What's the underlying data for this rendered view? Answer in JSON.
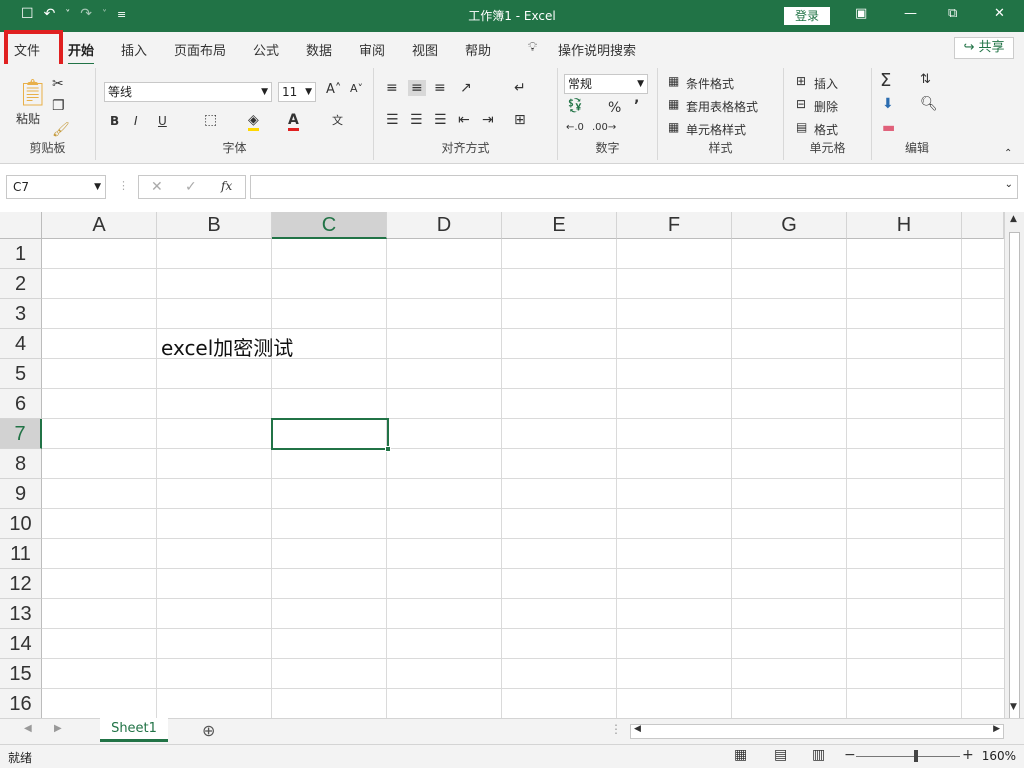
{
  "titlebar": {
    "qat": [
      "☐",
      "↶",
      "˅",
      "↷",
      "˅",
      "≡"
    ],
    "title": "工作簿1  -  Excel",
    "login": "登录",
    "window_buttons": [
      "▣",
      "—",
      "⧉",
      "✕"
    ]
  },
  "tabs": [
    {
      "label": "文件"
    },
    {
      "label": "开始",
      "active": true
    },
    {
      "label": "插入"
    },
    {
      "label": "页面布局"
    },
    {
      "label": "公式"
    },
    {
      "label": "数据"
    },
    {
      "label": "审阅"
    },
    {
      "label": "视图"
    },
    {
      "label": "帮助"
    }
  ],
  "tellme": "操作说明搜索",
  "share": "共享",
  "ribbon": {
    "clipboard": {
      "paste": "粘贴",
      "label": "剪贴板"
    },
    "font": {
      "name": "等线",
      "size": "11",
      "bold": "B",
      "italic": "I",
      "underline": "U",
      "label": "字体"
    },
    "alignment": {
      "label": "对齐方式"
    },
    "number": {
      "format": "常规",
      "percent": "%",
      "comma": "’",
      "label": "数字"
    },
    "styles": {
      "conditional": "条件格式",
      "table": "套用表格格式",
      "cell": "单元格样式",
      "label": "样式"
    },
    "cells": {
      "insert": "插入",
      "delete": "删除",
      "format": "格式",
      "label": "单元格"
    },
    "editing": {
      "label": "编辑"
    }
  },
  "formula_bar": {
    "namebox": "C7",
    "formula": "",
    "fx": "fx"
  },
  "columns": [
    "A",
    "B",
    "C",
    "D",
    "E",
    "F",
    "G",
    "H"
  ],
  "rows": [
    "1",
    "2",
    "3",
    "4",
    "5",
    "6",
    "7",
    "8",
    "9",
    "10",
    "11",
    "12",
    "13",
    "14",
    "15",
    "16"
  ],
  "cell_B4": "excel加密测试",
  "sheet_tab": "Sheet1",
  "status": {
    "ready": "就绪",
    "zoom": "160%"
  },
  "colors": {
    "accent": "#217346",
    "highlight_box": "#e02020"
  }
}
